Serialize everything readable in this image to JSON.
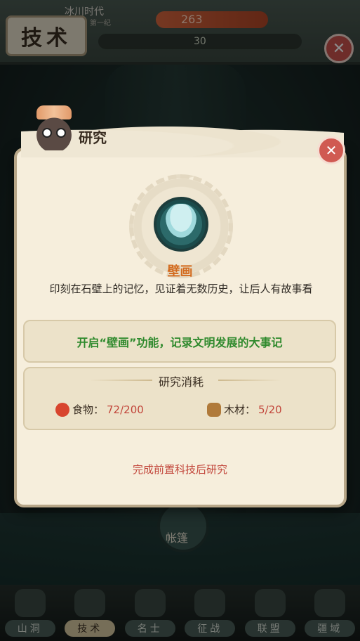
{
  "topbar": {
    "title": "技术",
    "era_name": "冰川时代",
    "era_sub": "第一纪",
    "prestige_value": "263",
    "resource_value": "30"
  },
  "dialog": {
    "title": "研究",
    "tech_name": "壁画",
    "tech_description": "印刻在石壁上的记忆，见证着无数历史，让后人有故事看",
    "effect_text": "开启“壁画”功能，记录文明发展的大事记",
    "cost_title": "研究消耗",
    "costs": [
      {
        "name": "食物：",
        "value": "72/200",
        "icon": "food-icon",
        "color": "#d8452e"
      },
      {
        "name": "木材：",
        "value": "5/20",
        "icon": "wood-icon",
        "color": "#b07a3a"
      }
    ],
    "status_text": "完成前置科技后研究"
  },
  "background": {
    "node_label": "帐篷"
  },
  "bottom_nav": [
    {
      "label": "山洞",
      "icon": "cave-icon"
    },
    {
      "label": "技术",
      "icon": "leaf-icon"
    },
    {
      "label": "名士",
      "icon": "hat-icon"
    },
    {
      "label": "征战",
      "icon": "target-icon"
    },
    {
      "label": "联盟",
      "icon": "banner-icon"
    },
    {
      "label": "疆域",
      "icon": "map-icon"
    }
  ],
  "colors": {
    "accent_orange": "#d36a1d",
    "effect_green": "#2f8a2d",
    "warning_red": "#c2463b"
  }
}
